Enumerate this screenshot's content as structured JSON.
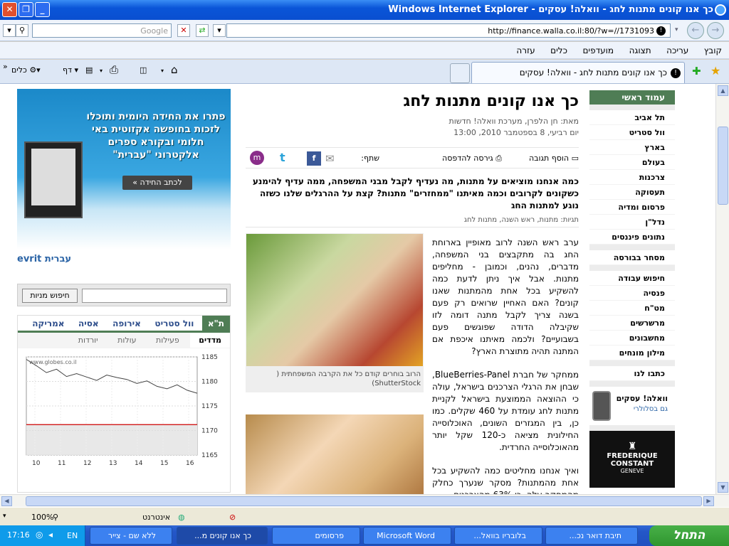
{
  "window": {
    "title": "כך אנו קונים מתנות לחג - וואלה! עסקים - Windows Internet Explorer"
  },
  "address": {
    "url": "http://finance.walla.co.il:80/?w=//1731093",
    "search_placeholder": "Google"
  },
  "menu": [
    "קובץ",
    "עריכה",
    "תצוגה",
    "מועדפים",
    "כלים",
    "עזרה"
  ],
  "tab": {
    "label": "כך אנו קונים מתנות לחג - וואלה! עסקים"
  },
  "toolbar": {
    "page": "דף",
    "tools": "כלים"
  },
  "nav": {
    "header": "עמוד ראשי",
    "items": [
      "תל אביב",
      "וול סטריט",
      "בארץ",
      "בעולם",
      "צרכנות",
      "תעסוקה",
      "פרסום ומדיה",
      "נדל\"ן",
      "נתונים פיננסים"
    ],
    "items2": [
      "מסחר בבורסה"
    ],
    "items3": [
      "חיפוש עבודה",
      "פנסיה",
      "מט\"ח",
      "מרשרשים",
      "מחשבונים",
      "מילון מונחים"
    ],
    "contact": "כתבו לנו",
    "promo_title": "וואלה! עסקים",
    "promo_sub": "גם בסלולרי",
    "ad": "FREDERIQUE CONSTANT",
    "ad_sub": "GENEVE"
  },
  "article": {
    "title": "כך אנו קונים מתנות לחג",
    "author": "מאת: חן הלפרן, מערכת וואלה! חדשות",
    "date": "יום רביעי, 8 בספטמבר 2010, 13:00",
    "add_comment": "הוסף תגובה",
    "print": "גירסה להדפסה",
    "share": "שתף:",
    "lead": "כמה אנחנו מוציאים על מתנות, מה נעדיף לקבל מבני המשפחה, ממה עדיף להימנע כשקונים לקרובים וכמה מאיתנו \"ממחזרים\" מתנות? קצת על ההרגלים שלנו כשזה נוגע למתנות החג",
    "tags": "תגיות: מתנות, ראש השנה, מתנות לחג",
    "p1": "ערב ראש השנה לרוב מאופיין בארוחת החג בה מתקבצים בני המשפחה, מדברים, נהנים, וכמובן - מחליפים מתנות. אבל איך ניתן לדעת כמה להשקיע בכל אחת מהמתנות שאנו קונים? האם האחיין שרואים רק פעם בשנה צריך לקבל מתנה דומה לזו שקיבלה הדודה שפוגשים פעם בשבועיים? ולכמה מאיתנו איכפת אם המתנה תהיה מתוצרת הארץ?",
    "p2": "ממחקר של חברת BlueBerries-Panel, שבחן את הרגלי הצרכנים בישראל, עולה כי ההוצאה הממוצעת בישראל לקניית מתנות לחג עומדת על 460 שקלים. כמו כן, בין המגזרים השונים, האוכלוסייה החילונית מציאה כ-120 שקל יותר מהאוכלוסייה החרדית.",
    "p3": "ואיך אנחנו מחליטים כמה להשקיע בכל אחת מהמתנות? מסקר שנערך כחלק מהמחקר עלה, כי 63% מהצרכנים",
    "caption": "הרוב בוחרים קודם כל את הקרבה המשפחתית ( ShutterStock)"
  },
  "banner": {
    "text": "פתרו את החידה היומית ותוכלו לזכות בחופשה אקזוטית באי חלומי ובקורא ספרים אלקטרוני \"עברית\"",
    "button": "לכתב החידה »",
    "logo": "evrit עברית"
  },
  "stock": {
    "button": "חיפוש מניות",
    "tabs": [
      "ת\"א",
      "וול סטריט",
      "אירופה",
      "אסיה",
      "אמריקה"
    ],
    "subtabs": [
      "מדדים",
      "פעילות",
      "עולות",
      "יורדות"
    ],
    "watermark": "www.globes.co.il"
  },
  "chart_data": {
    "type": "line",
    "x": [
      10,
      11,
      12,
      13,
      14,
      15,
      16
    ],
    "values": [
      1184.5,
      1183.2,
      1181.8,
      1182.5,
      1181.0,
      1181.6,
      1180.9,
      1180.2,
      1181.3,
      1180.8,
      1180.4,
      1179.6,
      1180.1,
      1179.0,
      1178.5,
      1179.3,
      1178.2,
      1177.6
    ],
    "yticks": [
      1185,
      1180,
      1175,
      1170,
      1165
    ],
    "xticks": [
      "10",
      "11",
      "12",
      "13",
      "14",
      "15",
      "16"
    ],
    "ylim": [
      1165,
      1185
    ],
    "reference": 1171.2
  },
  "status": {
    "zone": "אינטרנט",
    "zoom": "100%"
  },
  "taskbar": {
    "start": "התחל",
    "tasks": [
      "תיבת דואר נכ...",
      "בלובריו בוואל...",
      "Microsoft Word",
      "פרסומים",
      "כך אנו קונים מ...",
      "ללא שם - צייר"
    ],
    "lang": "EN",
    "clock": "17:16"
  },
  "colors": {
    "nav_green": "#4f7d55",
    "title_blue": "#0a55d8"
  }
}
